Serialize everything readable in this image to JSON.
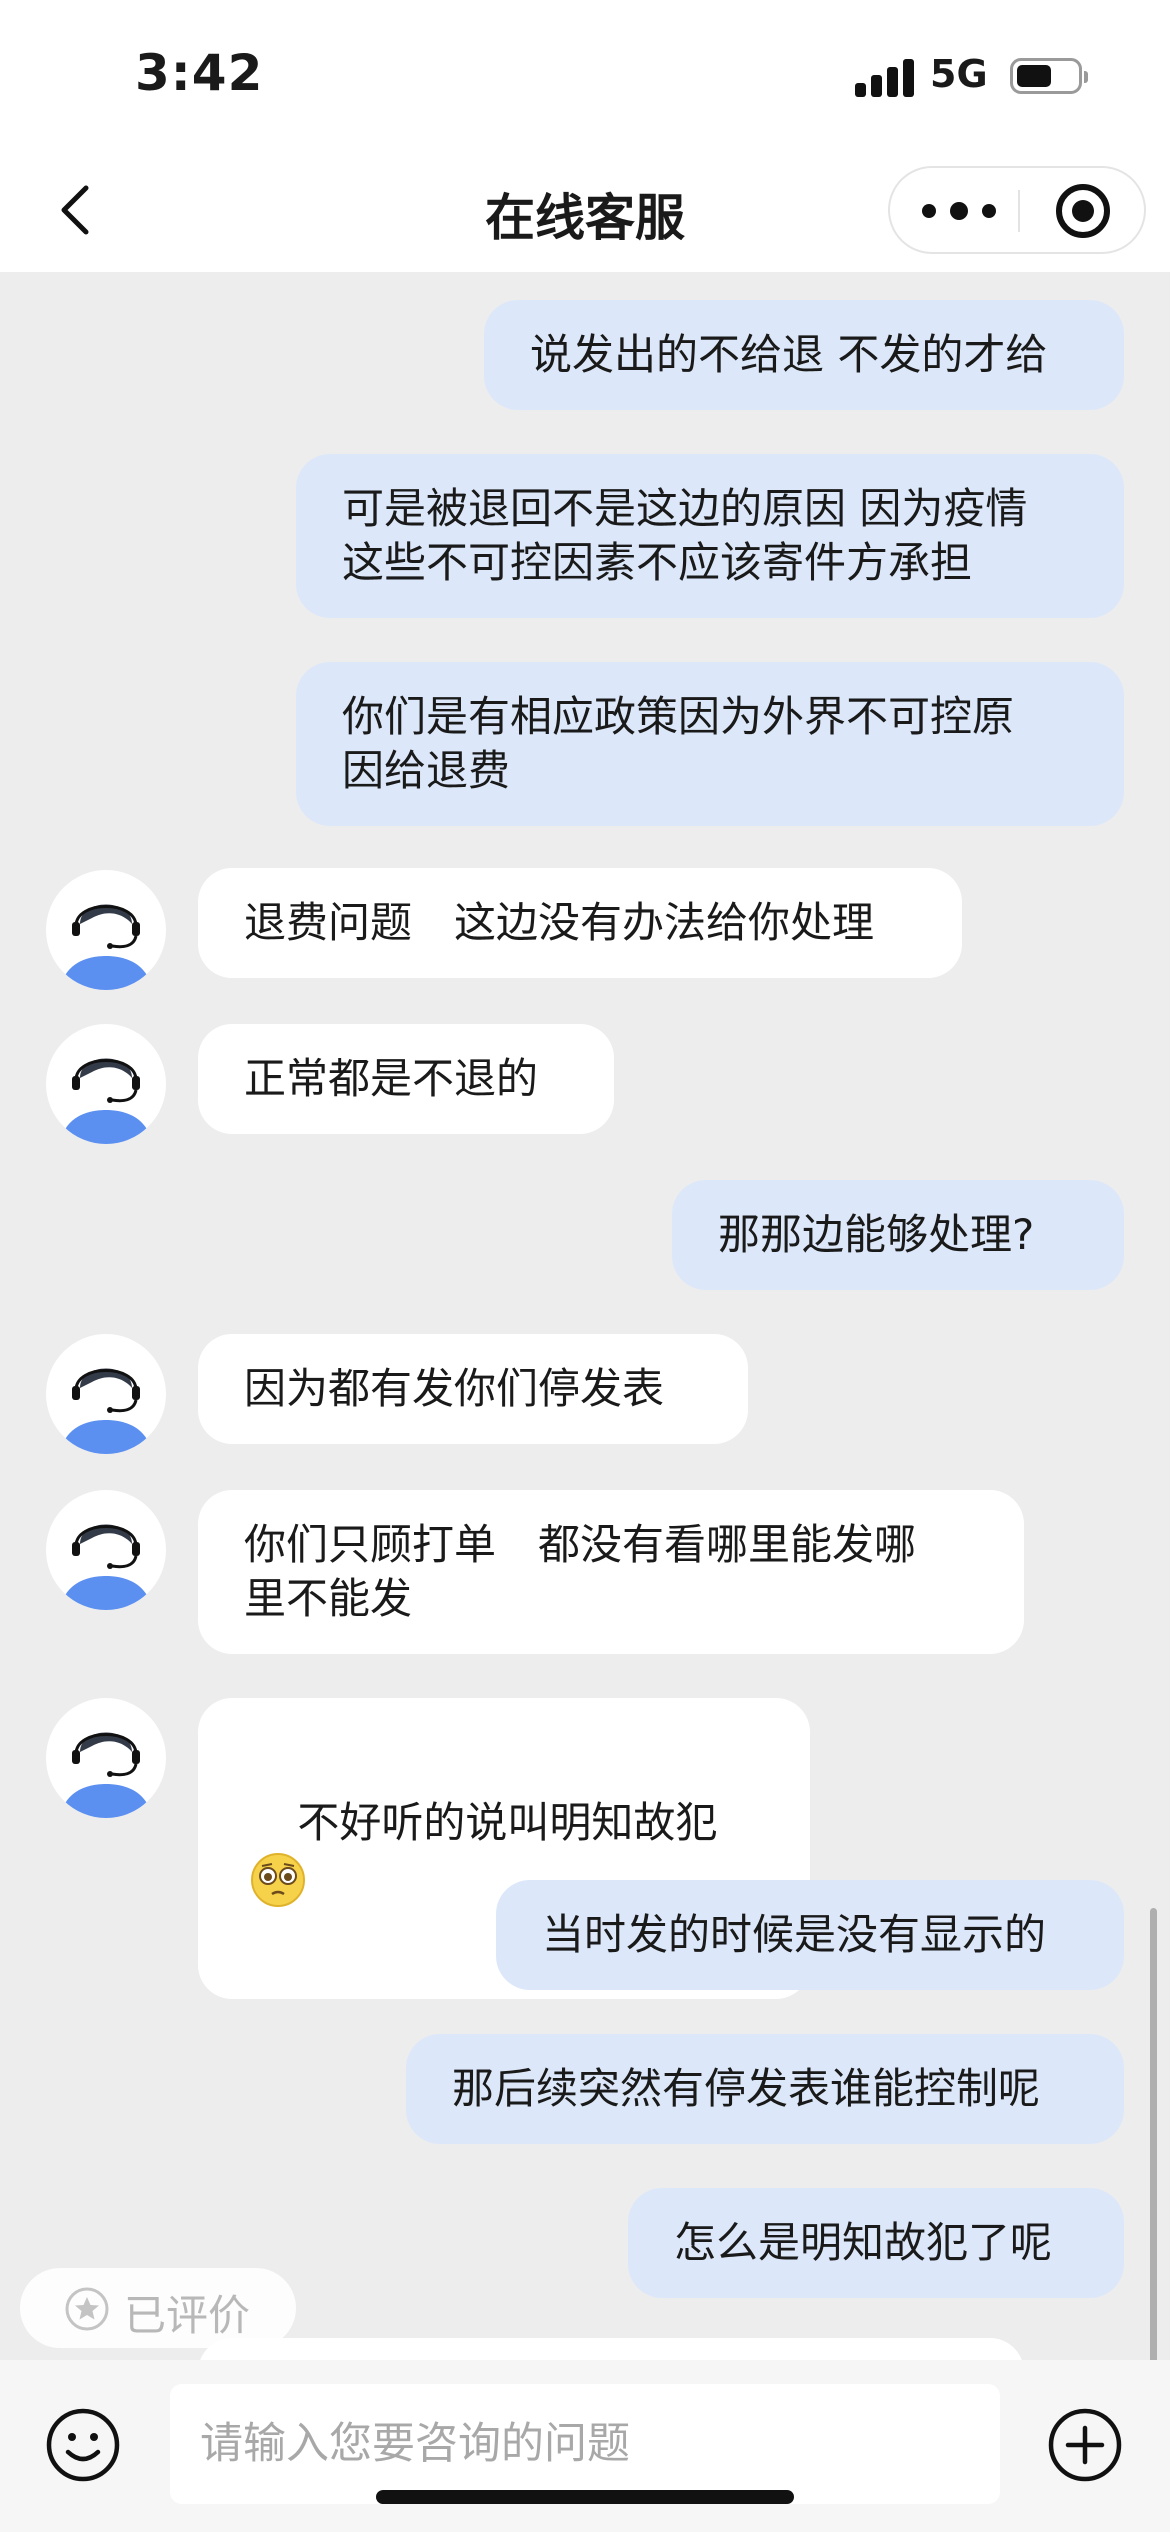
{
  "status_bar": {
    "time": "3:42",
    "network": "5G"
  },
  "nav": {
    "title": "在线客服",
    "back_icon": "chevron-left-icon",
    "more_icon": "more-dots-icon",
    "target_icon": "target-icon"
  },
  "messages": [
    {
      "sender": "user",
      "text": "说发出的不给退 不发的才给"
    },
    {
      "sender": "user",
      "text": "可是被退回不是这边的原因 因为疫情\n这些不可控因素不应该寄件方承担"
    },
    {
      "sender": "user",
      "text": "你们是有相应政策因为外界不可控原\n因给退费"
    },
    {
      "sender": "agent",
      "text": "退费问题　这边没有办法给你处理"
    },
    {
      "sender": "agent",
      "text": "正常都是不退的"
    },
    {
      "sender": "user",
      "text": "那那边能够处理?"
    },
    {
      "sender": "agent",
      "text": "因为都有发你们停发表"
    },
    {
      "sender": "agent",
      "text": "你们只顾打单　都没有看哪里能发哪\n里不能发"
    },
    {
      "sender": "agent",
      "text": "不好听的说叫明知故犯",
      "emoji": "pleading-face-icon"
    },
    {
      "sender": "user",
      "text": "当时发的时候是没有显示的"
    },
    {
      "sender": "user",
      "text": "那后续突然有停发表谁能控制呢"
    },
    {
      "sender": "user",
      "text": "怎么是明知故犯了呢"
    }
  ],
  "rating": {
    "label": "已评价",
    "icon": "star-icon"
  },
  "input": {
    "placeholder": "请输入您要咨询的问题",
    "emoji_icon": "smiley-icon",
    "add_icon": "plus-circle-icon"
  },
  "colors": {
    "user_bubble": "#dce8f9",
    "agent_bubble": "#ffffff",
    "chat_background": "#ededed",
    "avatar_accent": "#5b8ff0"
  }
}
